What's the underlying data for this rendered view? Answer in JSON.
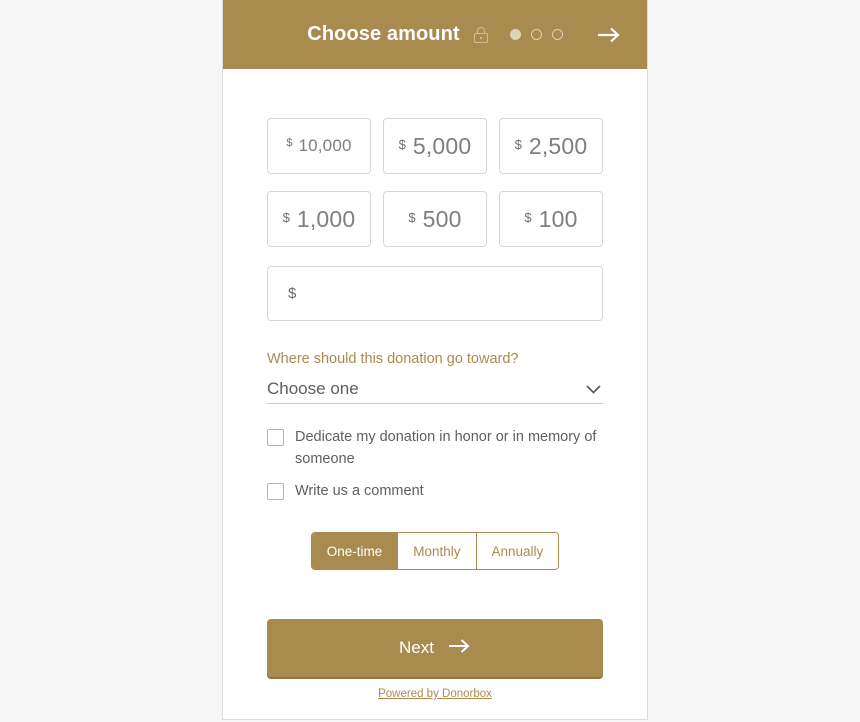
{
  "theme": {
    "accent": "#a98b4f",
    "accent_dark": "#8e7440",
    "page_bg": "#f6f6f6",
    "card_bg": "#ffffff",
    "border": "#d6d6d6",
    "text_muted": "#7f7f7f"
  },
  "header": {
    "title": "Choose amount",
    "lock_icon": "lock-icon",
    "steps": {
      "total": 3,
      "current": 1
    },
    "next_arrow_icon": "arrow-right-icon"
  },
  "amounts": [
    {
      "currency": "$",
      "value": "10,000",
      "small": true
    },
    {
      "currency": "$",
      "value": "5,000",
      "small": false
    },
    {
      "currency": "$",
      "value": "2,500",
      "small": false
    },
    {
      "currency": "$",
      "value": "1,000",
      "small": false
    },
    {
      "currency": "$",
      "value": "500",
      "small": false
    },
    {
      "currency": "$",
      "value": "100",
      "small": false
    }
  ],
  "custom_amount": {
    "currency": "$",
    "value": "",
    "placeholder": ""
  },
  "designation": {
    "label": "Where should this donation go toward?",
    "selected": "Choose one",
    "chevron_icon": "chevron-down-icon"
  },
  "checkboxes": [
    {
      "label": "Dedicate my donation in honor or in memory of someone",
      "checked": false
    },
    {
      "label": "Write us a comment",
      "checked": false
    }
  ],
  "frequency": {
    "options": [
      {
        "label": "One-time",
        "active": true
      },
      {
        "label": "Monthly",
        "active": false
      },
      {
        "label": "Annually",
        "active": false
      }
    ]
  },
  "next_button": {
    "label": "Next",
    "icon": "arrow-right-icon"
  },
  "footer": {
    "link_text": "Powered by Donorbox"
  }
}
